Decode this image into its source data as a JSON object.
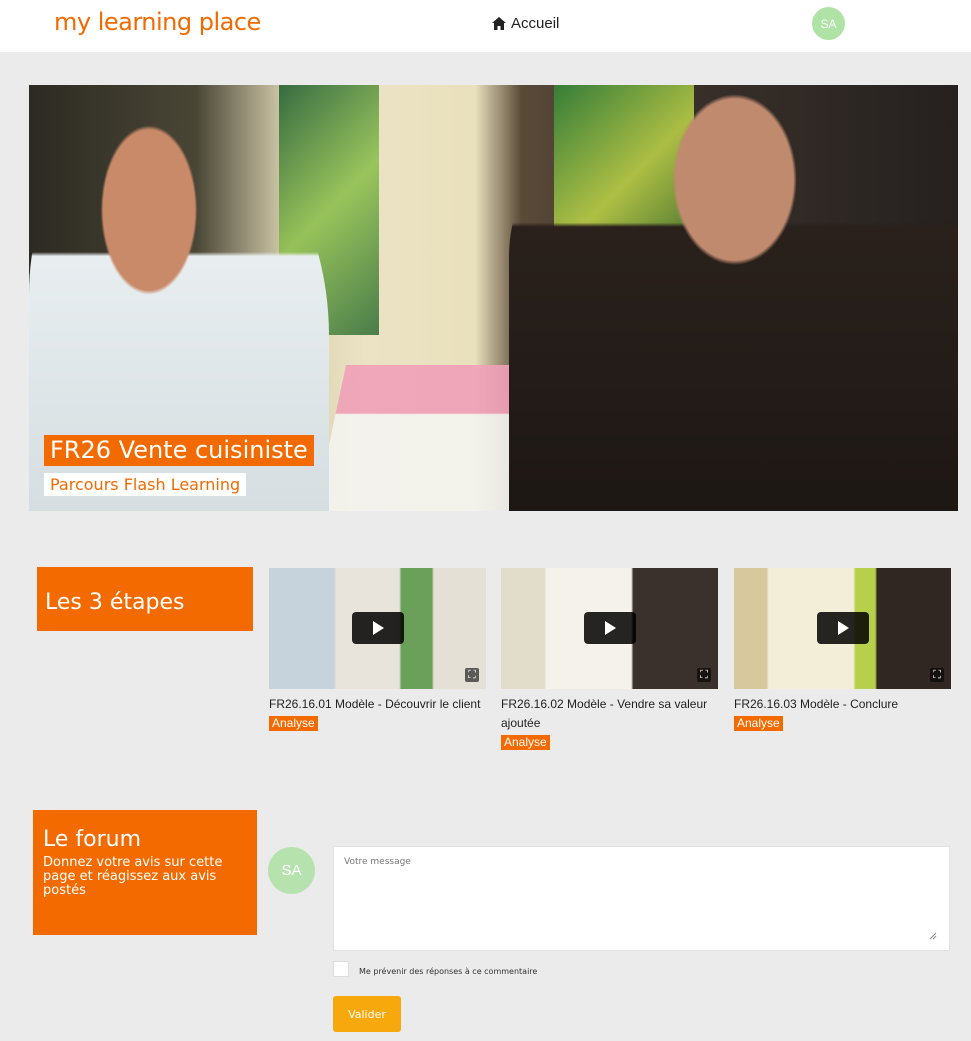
{
  "header": {
    "logo": "my learning place",
    "home_label": "Accueil",
    "avatar_initials": "SA"
  },
  "hero": {
    "title": "FR26 Vente cuisiniste",
    "subtitle": "Parcours Flash Learning"
  },
  "steps": {
    "heading": "Les 3 étapes",
    "videos": [
      {
        "title": "FR26.16.01 Modèle - Découvrir le client",
        "tag": "Analyse"
      },
      {
        "title": "FR26.16.02 Modèle - Vendre sa valeur ajoutée",
        "tag": "Analyse"
      },
      {
        "title": "FR26.16.03 Modèle - Conclure",
        "tag": "Analyse"
      }
    ]
  },
  "forum": {
    "heading": "Le forum",
    "description": "Donnez votre avis sur cette page et réagissez aux avis postés",
    "avatar_initials": "SA",
    "message_placeholder": "Votre message",
    "notify_label": "Me prévenir des réponses à ce commentaire",
    "submit_label": "Valider"
  },
  "colors": {
    "accent": "#f26a00",
    "button": "#f7a80c",
    "avatar": "#aee3a5"
  }
}
